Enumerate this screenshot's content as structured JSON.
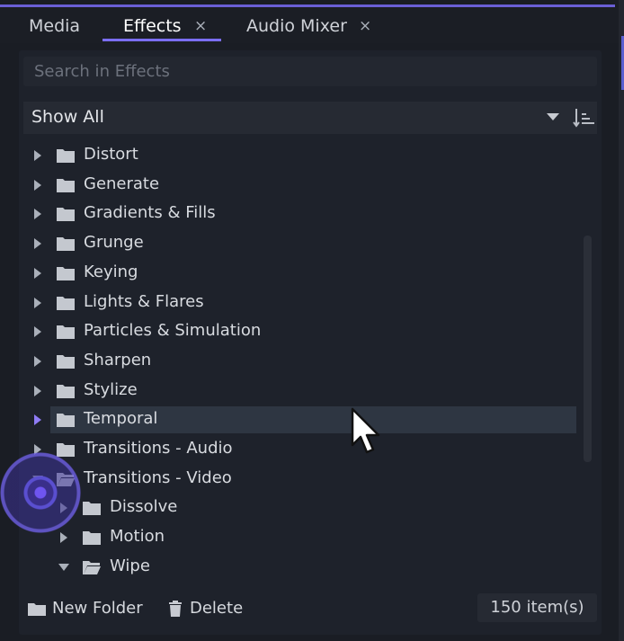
{
  "tabs": [
    {
      "label": "Media",
      "closable": false
    },
    {
      "label": "Effects",
      "closable": true,
      "active": true
    },
    {
      "label": "Audio Mixer",
      "closable": true
    }
  ],
  "close_glyph": "×",
  "search": {
    "placeholder": "Search in Effects"
  },
  "filter": {
    "selected": "Show All",
    "icons": [
      "dropdown-caret-icon",
      "sort-icon"
    ]
  },
  "tree": {
    "items": [
      {
        "label": "Distort",
        "level": 0,
        "state": "collapsed"
      },
      {
        "label": "Generate",
        "level": 0,
        "state": "collapsed"
      },
      {
        "label": "Gradients & Fills",
        "level": 0,
        "state": "collapsed"
      },
      {
        "label": "Grunge",
        "level": 0,
        "state": "collapsed"
      },
      {
        "label": "Keying",
        "level": 0,
        "state": "collapsed"
      },
      {
        "label": "Lights & Flares",
        "level": 0,
        "state": "collapsed"
      },
      {
        "label": "Particles & Simulation",
        "level": 0,
        "state": "collapsed"
      },
      {
        "label": "Sharpen",
        "level": 0,
        "state": "collapsed"
      },
      {
        "label": "Stylize",
        "level": 0,
        "state": "collapsed"
      },
      {
        "label": "Temporal",
        "level": 0,
        "state": "collapsed",
        "selected": true
      },
      {
        "label": "Transitions - Audio",
        "level": 0,
        "state": "collapsed"
      },
      {
        "label": "Transitions - Video",
        "level": 0,
        "state": "expanded"
      },
      {
        "label": "Dissolve",
        "level": 1,
        "state": "collapsed"
      },
      {
        "label": "Motion",
        "level": 1,
        "state": "collapsed"
      },
      {
        "label": "Wipe",
        "level": 1,
        "state": "expanded"
      }
    ]
  },
  "footer": {
    "new_folder": "New Folder",
    "delete": "Delete",
    "count": "150 item(s)"
  },
  "colors": {
    "accent": "#7b6ef2",
    "background": "#1a1d24",
    "selected_row": "#2e3642"
  }
}
